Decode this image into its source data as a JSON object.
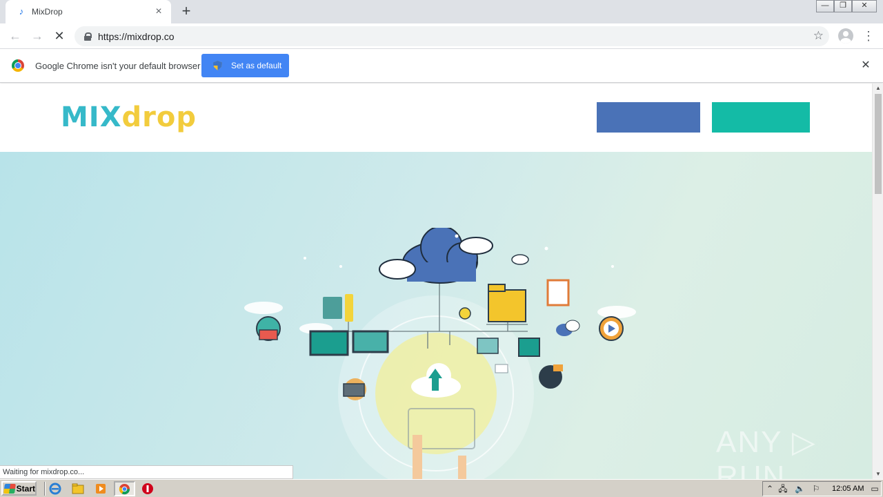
{
  "browser": {
    "tab": {
      "title": "MixDrop"
    },
    "window_controls": {
      "minimize": "—",
      "restore": "❐",
      "close": "✕"
    },
    "toolbar": {
      "url": "https://mixdrop.co"
    },
    "infobar": {
      "message": "Google Chrome isn't your default browser",
      "button_label": "Set as default"
    },
    "status_text": "Waiting for mixdrop.co..."
  },
  "site": {
    "logo": {
      "part1": "MIX",
      "part2": "drop"
    },
    "header_buttons": [
      {
        "label": "",
        "color": "#4a72b7"
      },
      {
        "label": "",
        "color": "#14bba6"
      }
    ],
    "hero_background": [
      "#b8e3e9",
      "#dcefe6"
    ]
  },
  "watermark": "ANY ▷ RUN",
  "taskbar": {
    "start_label": "Start",
    "clock": "12:05 AM"
  },
  "colors": {
    "chrome_blue": "#4285f4",
    "mix_cyan": "#36b9c9",
    "drop_yellow": "#f2cc3d"
  }
}
